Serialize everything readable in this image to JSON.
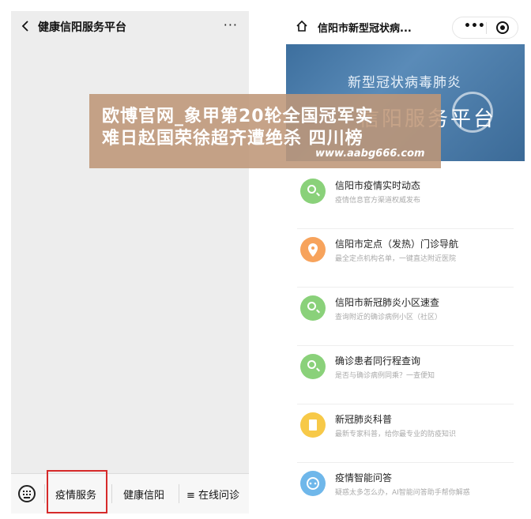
{
  "left_screen": {
    "title": "健康信阳服务平台",
    "more": "···",
    "tabs": [
      {
        "label": "疫情服务"
      },
      {
        "label": "健康信阳"
      },
      {
        "label": "≡ 在线问诊"
      }
    ]
  },
  "right_screen": {
    "title": "信阳市新型冠状病...",
    "capsule_more": "•••",
    "banner_line1": "新型冠状病毒肺炎",
    "banner_line2": "信阳服务平台",
    "items": [
      {
        "title": "信阳市疫情实时动态",
        "subtitle": "疫情信息官方渠道权威发布",
        "color": "#8ad17a",
        "icon": "search-icon"
      },
      {
        "title": "信阳市定点（发热）门诊导航",
        "subtitle": "最全定点机构名单，一键直达附近医院",
        "color": "#f7a35c",
        "icon": "location-pin-icon"
      },
      {
        "title": "信阳市新冠肺炎小区速查",
        "subtitle": "查询附近的确诊病例小区（社区）",
        "color": "#8ad17a",
        "icon": "search-icon"
      },
      {
        "title": "确诊患者同行程查询",
        "subtitle": "是否与确诊病例同乘？一查便知",
        "color": "#8ad17a",
        "icon": "search-icon"
      },
      {
        "title": "新冠肺炎科普",
        "subtitle": "最新专家科普，给你最专业的防疫知识",
        "color": "#f7c948",
        "icon": "book-icon"
      },
      {
        "title": "疫情智能问答",
        "subtitle": "疑惑太多怎么办，AI智能问答助手帮你解惑",
        "color": "#6fb7ea",
        "icon": "chat-bot-icon"
      }
    ]
  },
  "watermark": {
    "line1": "欧博官网_象甲第20轮全国冠军实",
    "line2": "难日赵国荣徐超齐遭绝杀 四川榜",
    "url": "www.aabg666.com"
  }
}
